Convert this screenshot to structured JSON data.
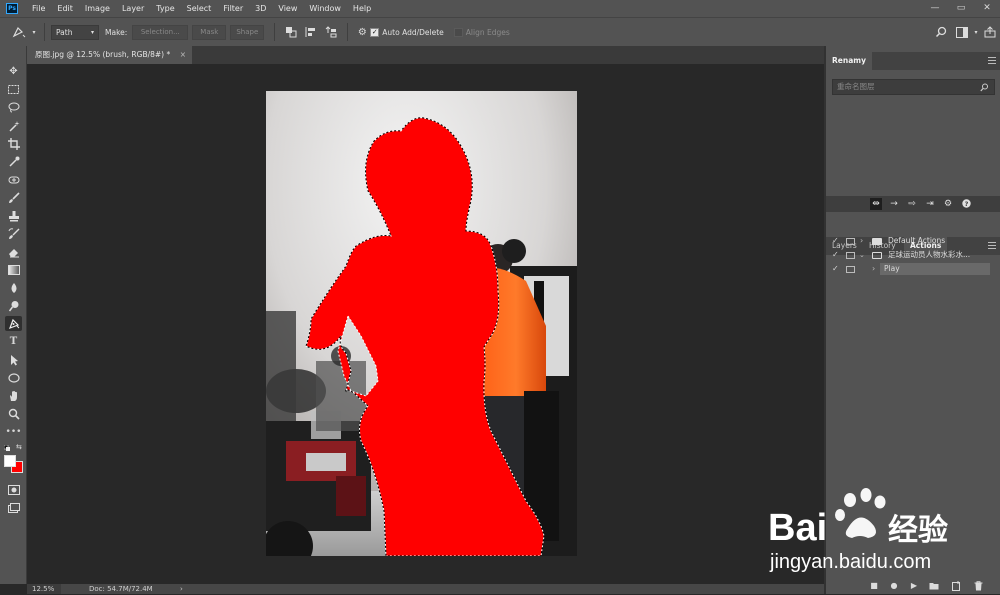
{
  "menubar": {
    "logo_label": "Ps",
    "items": [
      "File",
      "Edit",
      "Image",
      "Layer",
      "Type",
      "Select",
      "Filter",
      "3D",
      "View",
      "Window",
      "Help"
    ],
    "minimize": "—",
    "restore": "▭",
    "close": "✕"
  },
  "options": {
    "mode_value": "Path",
    "make_label": "Make:",
    "selection_btn": "Selection...",
    "mask_btn": "Mask",
    "shape_btn": "Shape",
    "auto_add_delete": "Auto Add/Delete",
    "align_edges": "Align Edges"
  },
  "document": {
    "tab_title": "原图.jpg @ 12.5% (brush, RGB/8#) *",
    "tab_close": "×"
  },
  "status": {
    "zoom": "12.5%",
    "doc": "Doc: 54.7M/72.4M",
    "arrow": "›"
  },
  "renamy": {
    "title": "Renamy",
    "search_placeholder": "重命名图层"
  },
  "panels": {
    "tabs": [
      "Layers",
      "History",
      "Actions"
    ],
    "active_tab": "Actions"
  },
  "actions": [
    {
      "label": "Default Actions",
      "expanded": false,
      "indent": 0
    },
    {
      "label": "足球运动员人物水彩水...",
      "expanded": true,
      "indent": 0
    },
    {
      "label": "Play",
      "expanded": false,
      "indent": 1
    }
  ],
  "watermark": {
    "brand_left": "Bai",
    "brand_right": "经验",
    "url": "jingyan.baidu.com"
  },
  "colors": {
    "foreground": "#ffffff",
    "background": "#ff0000",
    "accent": "#31a8ff"
  }
}
